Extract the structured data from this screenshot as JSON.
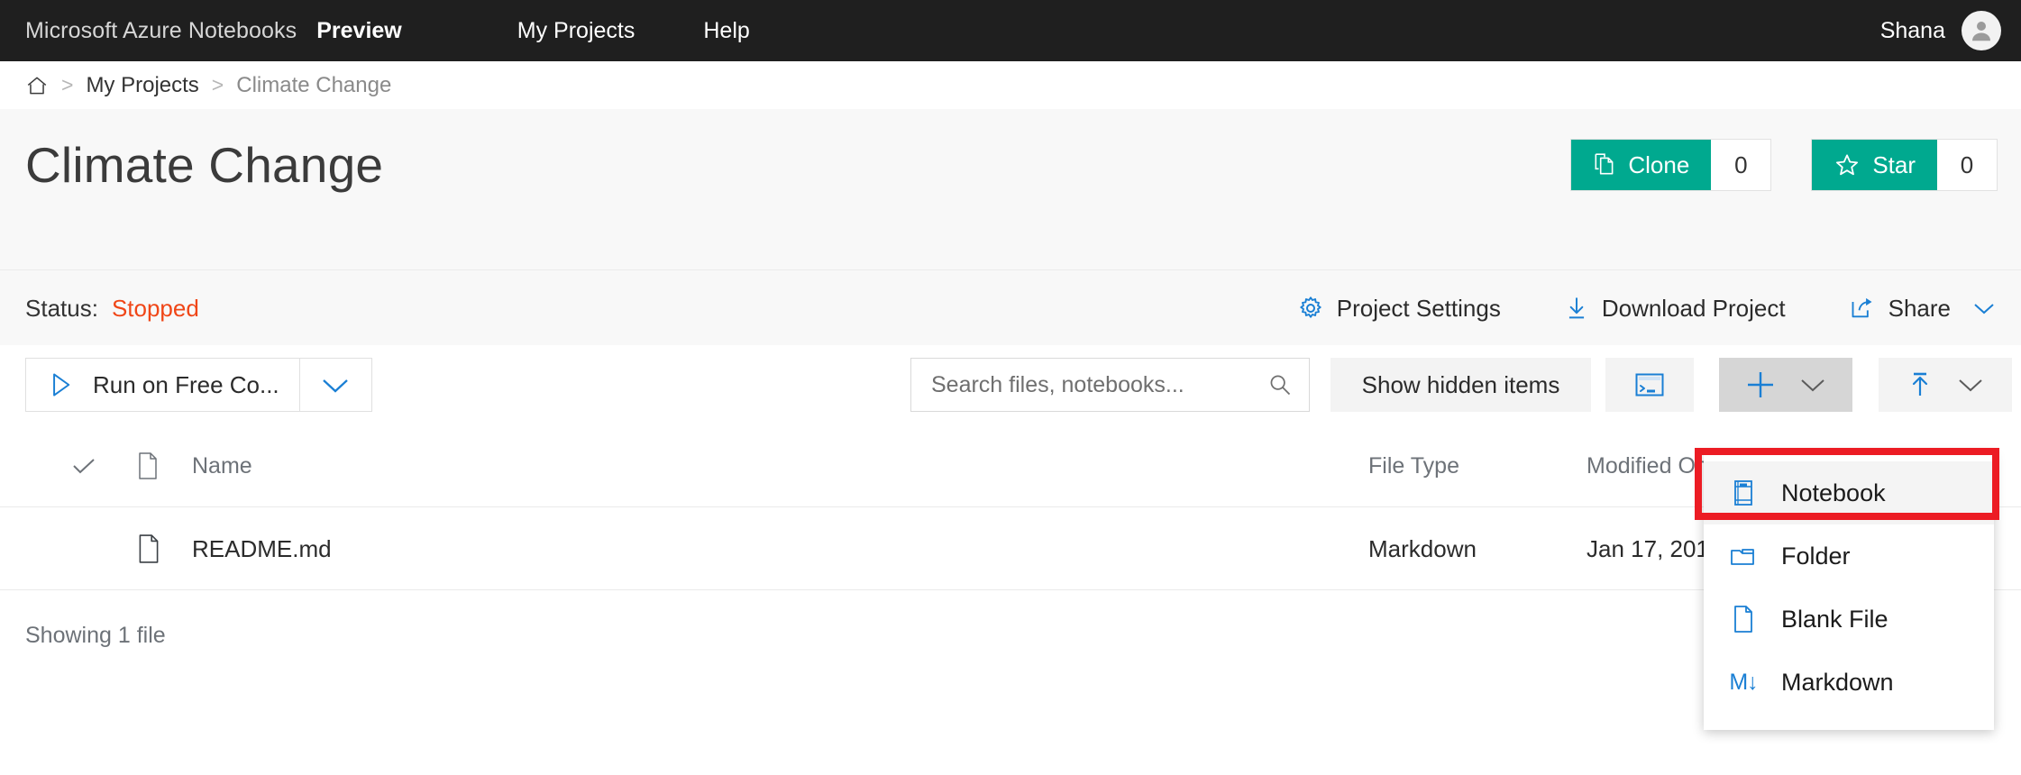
{
  "topnav": {
    "brand": "Microsoft Azure Notebooks",
    "preview": "Preview",
    "my_projects": "My Projects",
    "help": "Help",
    "user_name": "Shana",
    "avatar_icon": "person-icon"
  },
  "breadcrumb": {
    "home_icon": "home-icon",
    "separator": ">",
    "my_projects": "My Projects",
    "current": "Climate Change"
  },
  "header": {
    "title": "Climate Change",
    "clone": {
      "label": "Clone",
      "count": "0",
      "icon": "copy-icon"
    },
    "star": {
      "label": "Star",
      "count": "0",
      "icon": "star-icon"
    }
  },
  "status": {
    "label": "Status:",
    "value": "Stopped",
    "actions": [
      {
        "label": "Project Settings",
        "icon": "gear-icon"
      },
      {
        "label": "Download Project",
        "icon": "download-icon"
      },
      {
        "label": "Share",
        "icon": "share-icon",
        "caret": "chevron-down-icon"
      }
    ]
  },
  "toolbar": {
    "run_label": "Run on Free Co...",
    "run_icon": "play-icon",
    "run_caret": "chevron-down-icon",
    "search_placeholder": "Search files, notebooks...",
    "search_value": "",
    "search_icon": "search-icon",
    "show_hidden": "Show hidden items",
    "terminal_icon": "terminal-icon",
    "plus_icon": "plus-icon",
    "plus_caret": "chevron-down-icon",
    "upload_icon": "upload-icon",
    "upload_caret": "chevron-down-icon"
  },
  "table": {
    "headers": {
      "select_icon": "checkmark-icon",
      "file_icon": "file-icon",
      "name": "Name",
      "file_type": "File Type",
      "modified_on": "Modified On"
    },
    "rows": [
      {
        "icon": "file-icon",
        "name": "README.md",
        "file_type": "Markdown",
        "modified_on": "Jan 17, 201"
      }
    ],
    "footer": "Showing 1 file"
  },
  "menu": {
    "items": [
      {
        "label": "Notebook",
        "icon": "notebook-icon",
        "highlighted": true
      },
      {
        "label": "Folder",
        "icon": "folder-icon",
        "highlighted": false
      },
      {
        "label": "Blank File",
        "icon": "blank-file-icon",
        "highlighted": false
      },
      {
        "label": "Markdown",
        "icon": "markdown-icon",
        "glyph": "M↓",
        "highlighted": false
      }
    ]
  },
  "colors": {
    "nav_background": "#1f1f1f",
    "accent_green": "#00a98f",
    "accent_blue": "#1a7fd4",
    "status_stopped": "#f04617",
    "annotation_red": "#ec1c24",
    "band_background": "#f8f8f8"
  }
}
